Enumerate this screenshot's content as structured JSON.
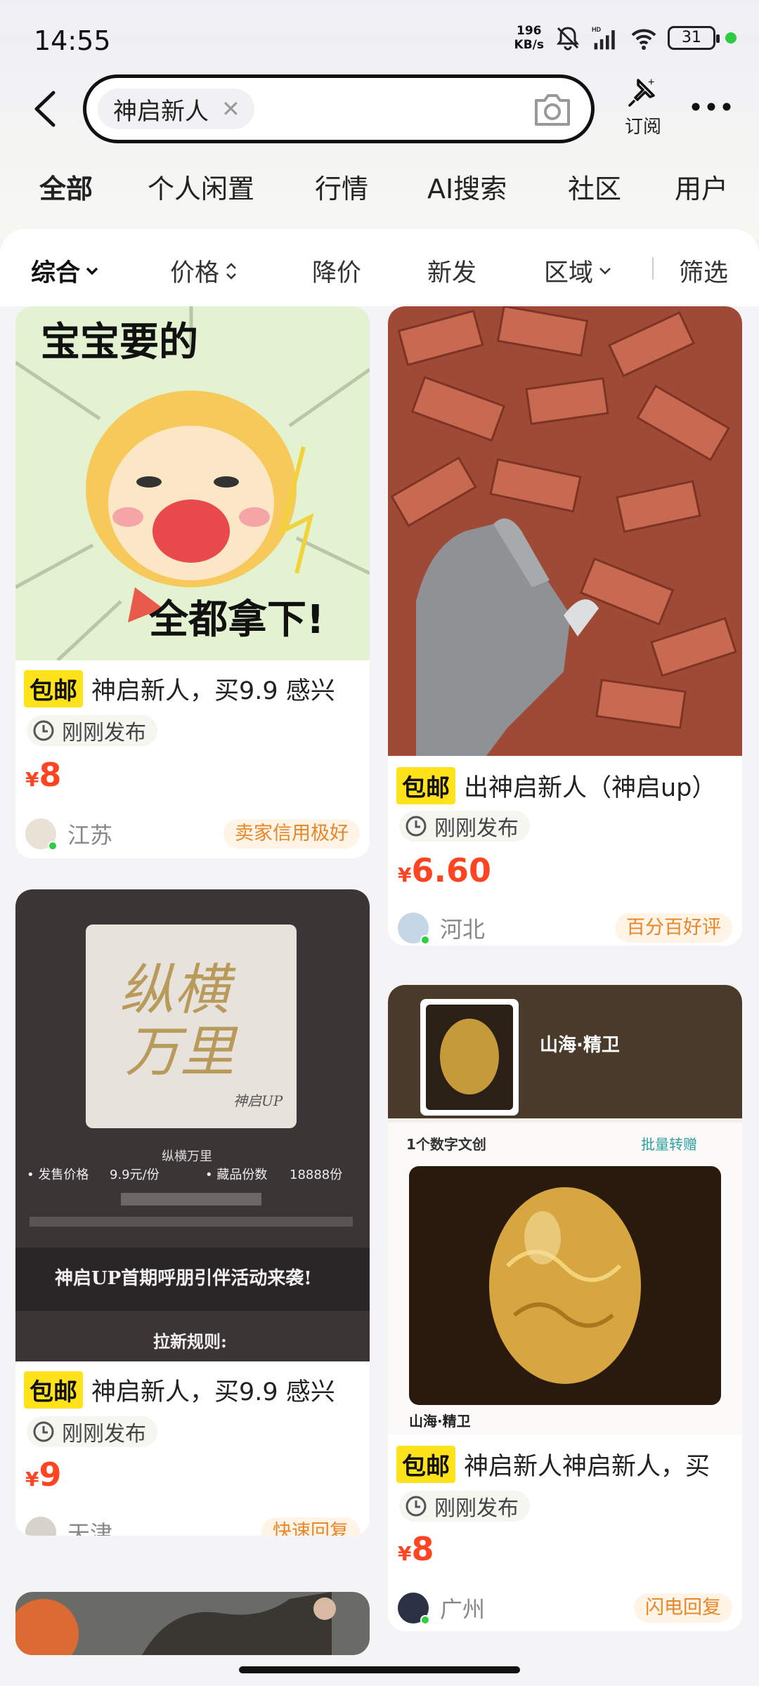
{
  "status": {
    "time": "14:55",
    "net_speed_value": "196",
    "net_speed_unit": "KB/s",
    "battery": "31"
  },
  "search": {
    "query": "神启新人",
    "subscribe_label": "订阅"
  },
  "tabs": [
    {
      "label": "全部",
      "active": true
    },
    {
      "label": "个人闲置"
    },
    {
      "label": "行情"
    },
    {
      "label": "AI搜索"
    },
    {
      "label": "社区"
    },
    {
      "label": "用户"
    }
  ],
  "filters": {
    "sort": "综合",
    "price": "价格",
    "price_drop": "降价",
    "new": "新发",
    "region": "区域",
    "filter": "筛选"
  },
  "cards": [
    {
      "free_ship": "包邮",
      "title": "神启新人，买9.9 感兴",
      "time": "刚刚发布",
      "currency": "¥",
      "price": "8",
      "region": "江苏",
      "badge": "卖家信用极好",
      "img_text_top": "宝宝要的",
      "img_text_bottom": "全都拿下!"
    },
    {
      "free_ship": "包邮",
      "title": "出神启新人（神启up）",
      "time": "刚刚发布",
      "currency": "¥",
      "price": "6.60",
      "region": "河北",
      "badge": "百分百好评"
    },
    {
      "free_ship": "包邮",
      "title": "神启新人，买9.9 感兴",
      "time": "刚刚发布",
      "currency": "¥",
      "price": "9",
      "region": "天津",
      "badge": "快速回复",
      "img_title_1": "纵横",
      "img_title_2": "万里",
      "img_brand": "神启UP",
      "img_sub": "纵横万里",
      "img_price_label": "• 发售价格",
      "img_price_value": "9.9元/份",
      "img_count_label": "• 藏品份数",
      "img_count_value": "18888份",
      "img_banner": "神启UP首期呼朋引伴活动来袭!",
      "img_rules": "拉新规则:"
    },
    {
      "free_ship": "包邮",
      "title": "神启新人神启新人，买",
      "time": "刚刚发布",
      "currency": "¥",
      "price": "8",
      "region": "广州",
      "badge": "闪电回复",
      "img_name_top": "山海·精卫",
      "img_count": "1个数字文创",
      "img_transfer": "批量转赠",
      "img_name_bottom": "山海·精卫"
    }
  ]
}
